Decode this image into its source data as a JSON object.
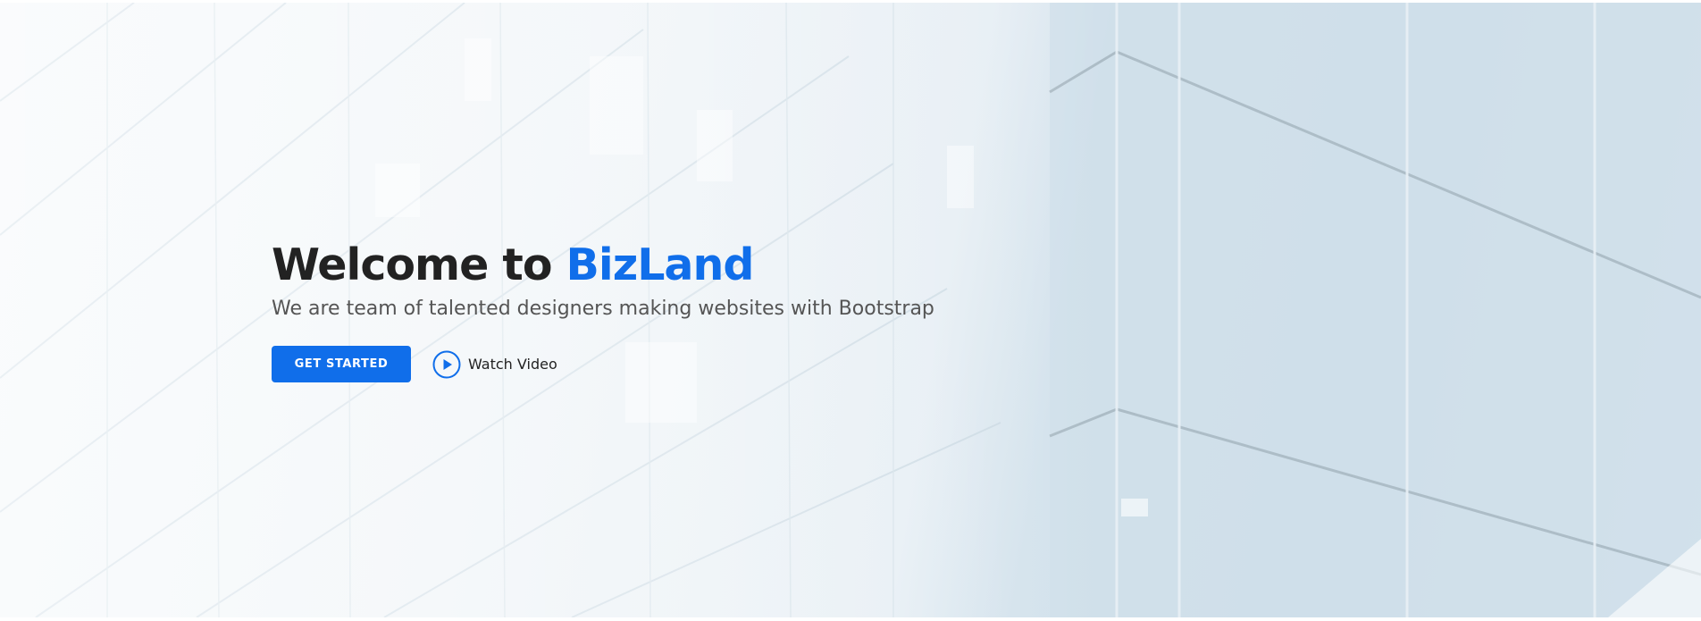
{
  "hero": {
    "title_prefix": "Welcome to ",
    "title_brand": "BizLand",
    "subtitle": "We are team of talented designers making websites with Bootstrap",
    "cta_label": "GET STARTED",
    "video_label": "Watch Video",
    "background_image": "glass-building-facade",
    "play_icon": "play-circle-icon"
  },
  "colors": {
    "accent": "#106eea",
    "title": "#222222",
    "subtitle": "#555555",
    "background": "#dce8f0"
  }
}
